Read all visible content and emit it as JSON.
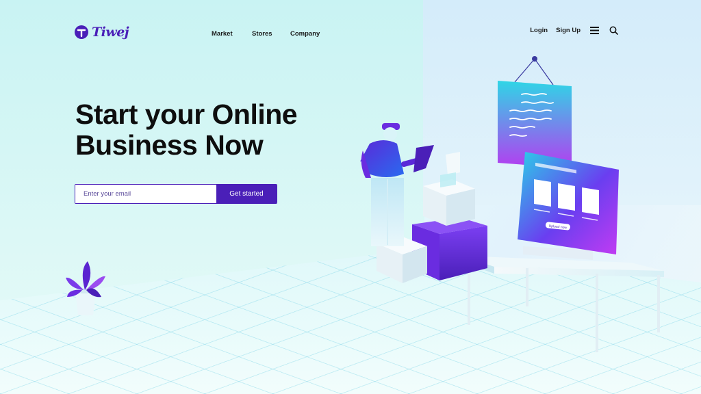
{
  "brand": {
    "name": "Tiwej",
    "color": "#4a1fb8"
  },
  "nav": {
    "links": [
      {
        "label": "Market"
      },
      {
        "label": "Stores"
      },
      {
        "label": "Company"
      }
    ],
    "login_label": "Login",
    "signup_label": "Sign Up",
    "menu_icon": "hamburger-menu-icon",
    "search_icon": "search-icon"
  },
  "hero": {
    "title_line1": "Start your Online",
    "title_line2": "Business Now"
  },
  "signup": {
    "email_placeholder": "Enter your email",
    "email_value": "",
    "button_label": "Get started"
  },
  "illustration": {
    "monitor_button": "Upload now"
  },
  "colors": {
    "accent": "#4a1fb8",
    "cyan": "#2ed3e6",
    "magenta": "#b23cf0"
  }
}
